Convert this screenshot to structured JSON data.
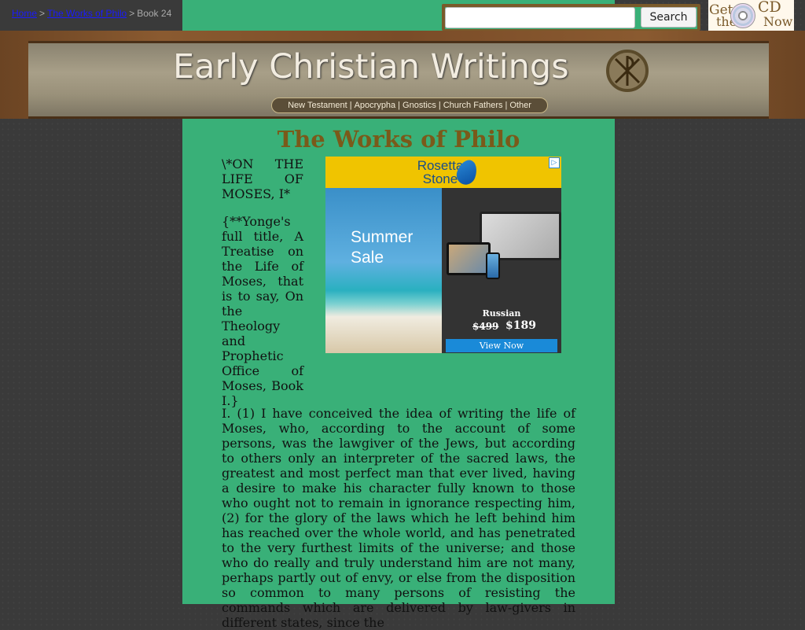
{
  "breadcrumb": {
    "items": [
      "Home",
      "The Works of Philo",
      "Book 24"
    ],
    "separator": ">"
  },
  "search": {
    "placeholder": "",
    "value": "",
    "button_label": "Search"
  },
  "promo": {
    "line1": "Get",
    "line2": "the",
    "line3": "CD",
    "line4": "Now!"
  },
  "banner": {
    "title": "Early Christian Writings",
    "nav": [
      "New Testament",
      "Apocrypha",
      "Gnostics",
      "Church Fathers",
      "Other"
    ],
    "nav_separator": "|"
  },
  "page": {
    "title": "The Works of Philo",
    "side_paragraphs": [
      "\\*ON THE LIFE OF MOSES, I*",
      "{**Yonge's full title, A Treatise on the Life of Moses, that is to say, On the Theology and Prophetic Office of Moses, Book I.}"
    ],
    "body_text": "I. (1) I have conceived the idea of writing the life of Moses, who, according to the account of some persons, was the lawgiver of the Jews, but according to others only an interpreter of the sacred laws, the greatest and most perfect man that ever lived, having a desire to make his character fully known to those who ought not to remain in ignorance respecting him, (2) for the glory of the laws which he left behind him has reached over the whole world, and has penetrated to the very furthest limits of the universe; and those who do really and truly understand him are not many, perhaps partly out of envy, or else from the disposition so common to many persons of resisting the commands which are delivered by law-givers in different states, since the"
  },
  "ad": {
    "brand": "Rosetta Stone",
    "sale_text": "Summer Sale",
    "language": "Russian",
    "old_price": "$499",
    "new_price": "$189",
    "cta": "View Now",
    "choice_icon": "ad-choices-icon"
  },
  "colors": {
    "background": "#3a3a3a",
    "content_green": "#39b078",
    "title_brown": "#7a5a1a",
    "link_blue": "#1a1aff"
  }
}
